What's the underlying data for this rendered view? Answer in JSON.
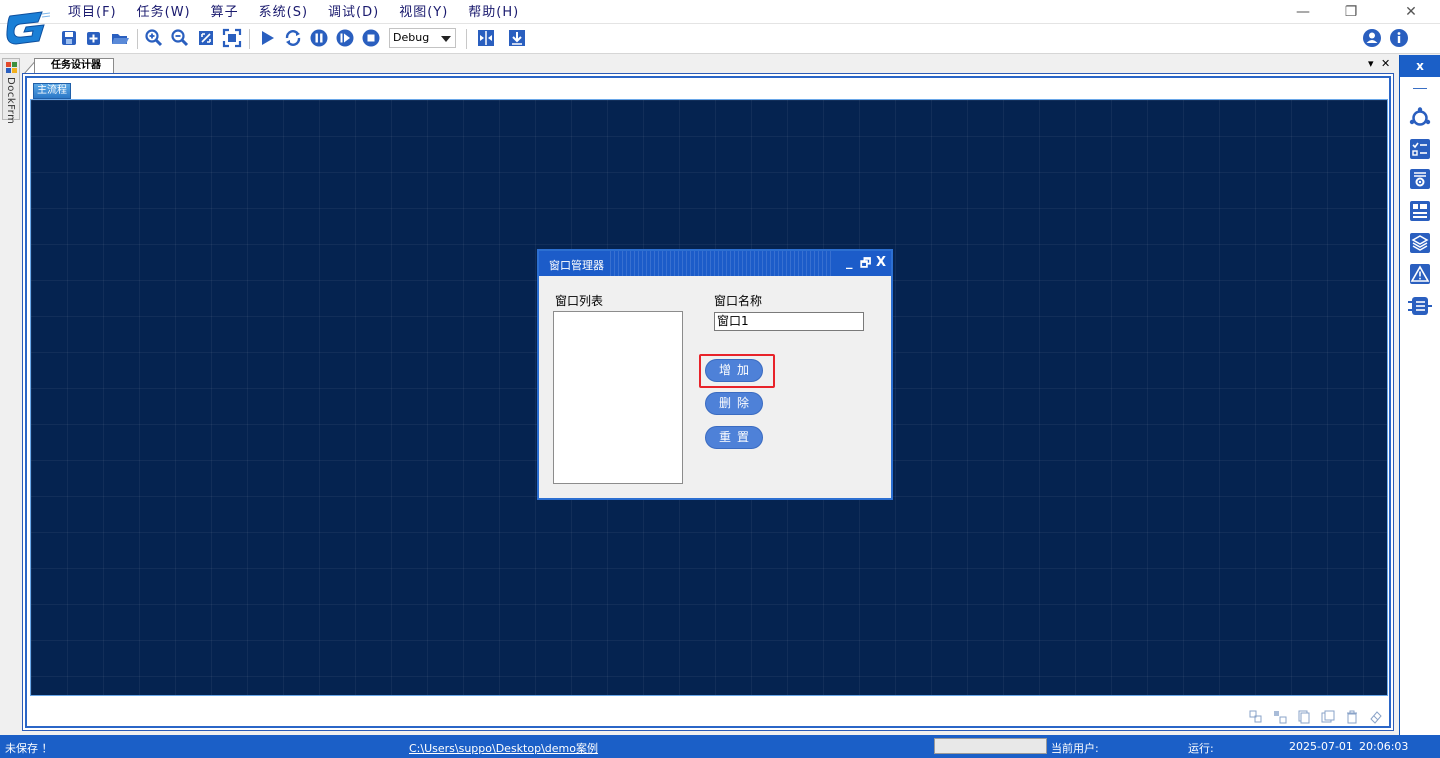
{
  "menu": [
    {
      "label": "项目(F)"
    },
    {
      "label": "任务(W)"
    },
    {
      "label": "算子"
    },
    {
      "label": "系统(S)"
    },
    {
      "label": "调试(D)"
    },
    {
      "label": "视图(Y)"
    },
    {
      "label": "帮助(H)"
    }
  ],
  "window_controls": {
    "minimize": "—",
    "restore": "❐",
    "close": "✕"
  },
  "toolbar": {
    "mode_select": "Debug",
    "icons": [
      "save-icon",
      "new-icon",
      "open-folder-icon",
      "zoom-in-icon",
      "zoom-out-icon",
      "fit-icon",
      "fullscreen-icon",
      "run-icon",
      "loop-icon",
      "pause-icon",
      "step-icon",
      "stop-icon",
      "split-icon",
      "download-icon",
      "user-icon",
      "info-icon"
    ],
    "accent": "#2a5fbf"
  },
  "left_dock": {
    "label": "DockFrm"
  },
  "doc_tabs": {
    "active": "任务设计器",
    "pin": "▾",
    "close": "✕"
  },
  "designer": {
    "sub_tab": "主流程"
  },
  "window_manager": {
    "title": "窗口管理器",
    "list_label": "窗口列表",
    "name_label": "窗口名称",
    "name_value": "窗口1",
    "add_button": "增加",
    "delete_button": "删除",
    "reset_button": "重置",
    "min": "_",
    "restore": "🗗",
    "close": "X"
  },
  "right_dock": {
    "close": "x"
  },
  "status": {
    "save_state": "未保存 ！",
    "path": "C:\\Users\\suppo\\Desktop\\demo案例",
    "user_label": "当前用户:",
    "run_label": "运行:",
    "date": "2025-07-01",
    "time": "20:06:03"
  }
}
